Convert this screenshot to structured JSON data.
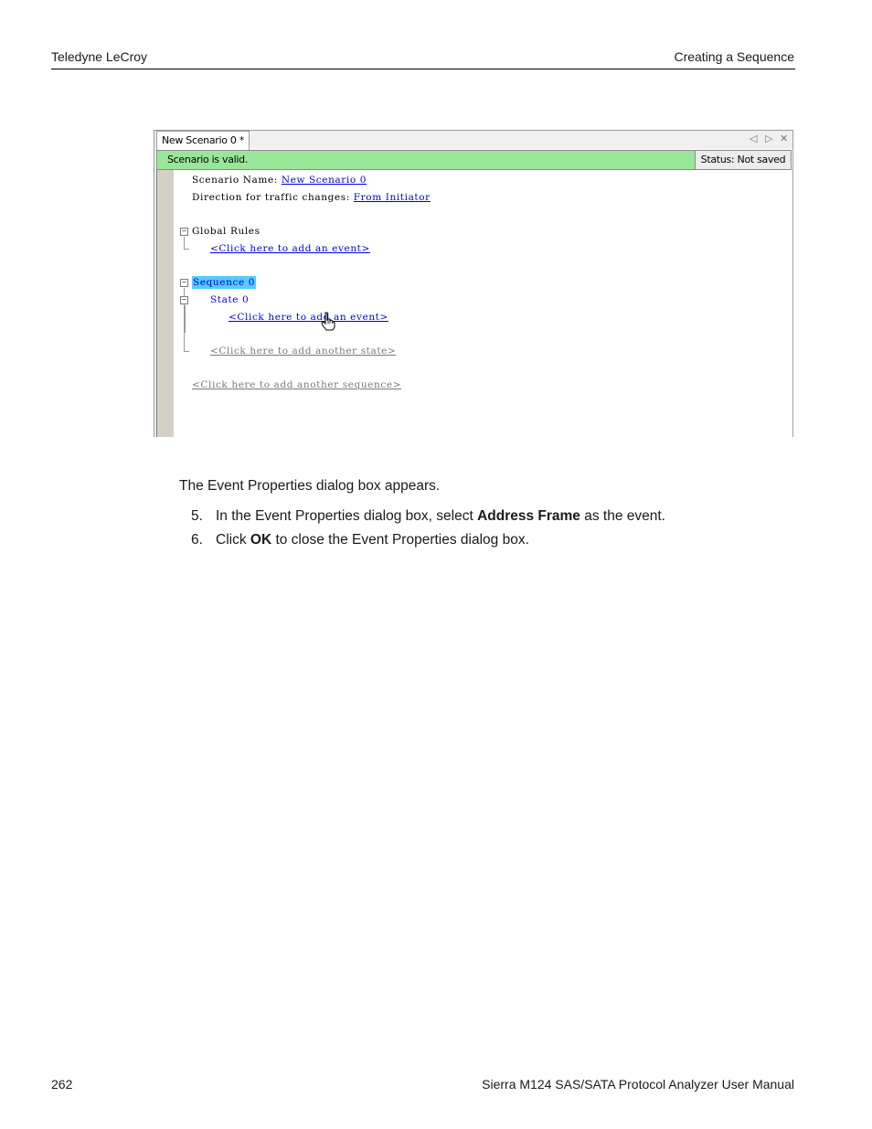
{
  "header": {
    "left": "Teledyne LeCroy",
    "right": "Creating a Sequence"
  },
  "screenshot": {
    "tab_label": "New Scenario 0 *",
    "tab_controls": {
      "prev": "◁",
      "next": "▷",
      "close": "✕"
    },
    "status_message": "Scenario is valid.",
    "status_saved": "Status: Not saved",
    "lines": {
      "scenario_name_label": "Scenario Name:",
      "scenario_name_value": "New Scenario 0",
      "direction_label": "Direction for traffic changes:",
      "direction_value": "From Initiator",
      "global_rules": "Global Rules",
      "global_add_event": "<Click here to add an event>",
      "sequence": "Sequence 0",
      "state": "State 0",
      "state_add_event": "<Click here to add an event>",
      "add_state": "<Click here to add another state>",
      "add_sequence": "<Click here to add another sequence>"
    },
    "toggle_symbol": "−"
  },
  "body": {
    "intro": "The Event Properties dialog box appears.",
    "steps": [
      {
        "num": "5.",
        "pre": "In the Event Properties dialog box, select ",
        "bold": "Address Frame",
        "post": " as the event."
      },
      {
        "num": "6.",
        "pre": "Click ",
        "bold": "OK",
        "post": " to close the Event Properties dialog box."
      }
    ]
  },
  "footer": {
    "page": "262",
    "title": "Sierra M124 SAS/SATA Protocol Analyzer User Manual"
  }
}
